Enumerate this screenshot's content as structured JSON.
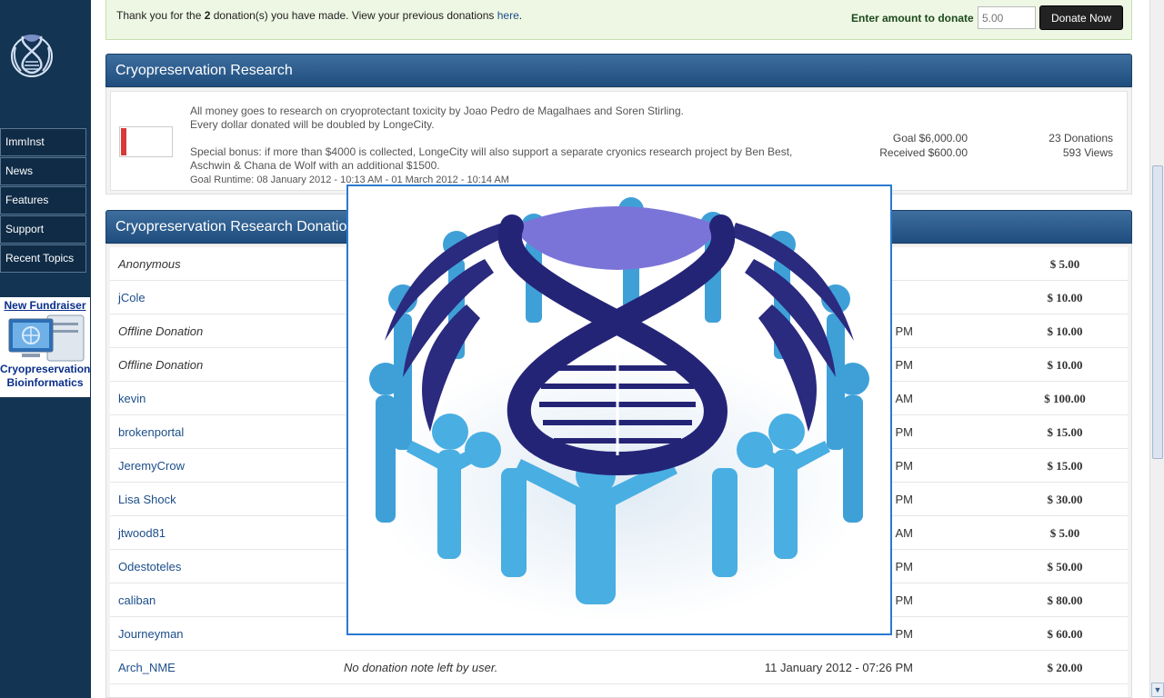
{
  "sidebar": {
    "nav": [
      "ImmInst",
      "News",
      "Features",
      "Support",
      "Recent Topics"
    ],
    "promo_top": "New Fundraiser",
    "promo_bottom_1": "Cryopreservation",
    "promo_bottom_2": "Bioinformatics"
  },
  "thanks": {
    "text_before": "Thank you for the ",
    "count": "2",
    "text_after": " donation(s) you have made. View your previous donations ",
    "link": "here",
    "period": ".",
    "amount_label": "Enter amount to donate",
    "amount_placeholder": "5.00",
    "donate_button": "Donate Now"
  },
  "goal": {
    "title": "Cryopreservation Research",
    "progress_fraction": 0.1,
    "desc_line1": "All money goes to research on cryoprotectant toxicity by Joao Pedro de Magalhaes and Soren Stirling.",
    "desc_line2": "Every dollar donated will be doubled by LongeCity.",
    "bonus_line1": "Special bonus: if more than $4000 is collected, LongeCity will also support a separate cryonics research project by Ben Best,",
    "bonus_line2": "Aschwin & Chana de Wolf with an additional $1500.",
    "runtime": "Goal Runtime: 08 January 2012 - 10:13 AM - 01 March 2012 - 10:14 AM",
    "goal_amount": "Goal $6,000.00",
    "received_amount": "Received $600.00",
    "donations": "23 Donations",
    "views": "593 Views"
  },
  "donations": {
    "title": "Cryopreservation Research Donations",
    "rows": [
      {
        "name": "Anonymous",
        "note": "",
        "date": "",
        "amount": "$ 5.00",
        "anon": true
      },
      {
        "name": "jCole",
        "note": "",
        "date": "",
        "amount": "$ 10.00",
        "anon": false
      },
      {
        "name": "Offline Donation",
        "note": "",
        "date": "PM",
        "amount": "$ 10.00",
        "anon": true
      },
      {
        "name": "Offline Donation",
        "note": "",
        "date": "PM",
        "amount": "$ 10.00",
        "anon": true
      },
      {
        "name": "kevin",
        "note": "",
        "date": "AM",
        "amount": "$ 100.00",
        "anon": false
      },
      {
        "name": "brokenportal",
        "note": "",
        "date": "PM",
        "amount": "$ 15.00",
        "anon": false
      },
      {
        "name": "JeremyCrow",
        "note": "",
        "date": "PM",
        "amount": "$ 15.00",
        "anon": false
      },
      {
        "name": "Lisa Shock",
        "note": "",
        "date": "PM",
        "amount": "$ 30.00",
        "anon": false
      },
      {
        "name": "jtwood81",
        "note": "",
        "date": "AM",
        "amount": "$ 5.00",
        "anon": false
      },
      {
        "name": "Odestoteles",
        "note": "",
        "date": "PM",
        "amount": "$ 50.00",
        "anon": false
      },
      {
        "name": "caliban",
        "note": "",
        "date": "PM",
        "amount": "$ 80.00",
        "anon": false
      },
      {
        "name": "Journeyman",
        "note": "",
        "date": "PM",
        "amount": "$ 60.00",
        "anon": false
      },
      {
        "name": "Arch_NME",
        "note": "No donation note left by user.",
        "date": "11 January 2012 - 07:26 PM",
        "amount": "$ 20.00",
        "anon": false
      }
    ]
  },
  "colors": {
    "sidebar_bg": "#133453",
    "header_blue": "#2a5c8e",
    "thanks_bg": "#eef7e4",
    "progress_red": "#d83a3a",
    "overlay_border": "#2a7ad0",
    "figure_blue": "#3fa0d8",
    "logo_navy": "#2a2a7e"
  }
}
